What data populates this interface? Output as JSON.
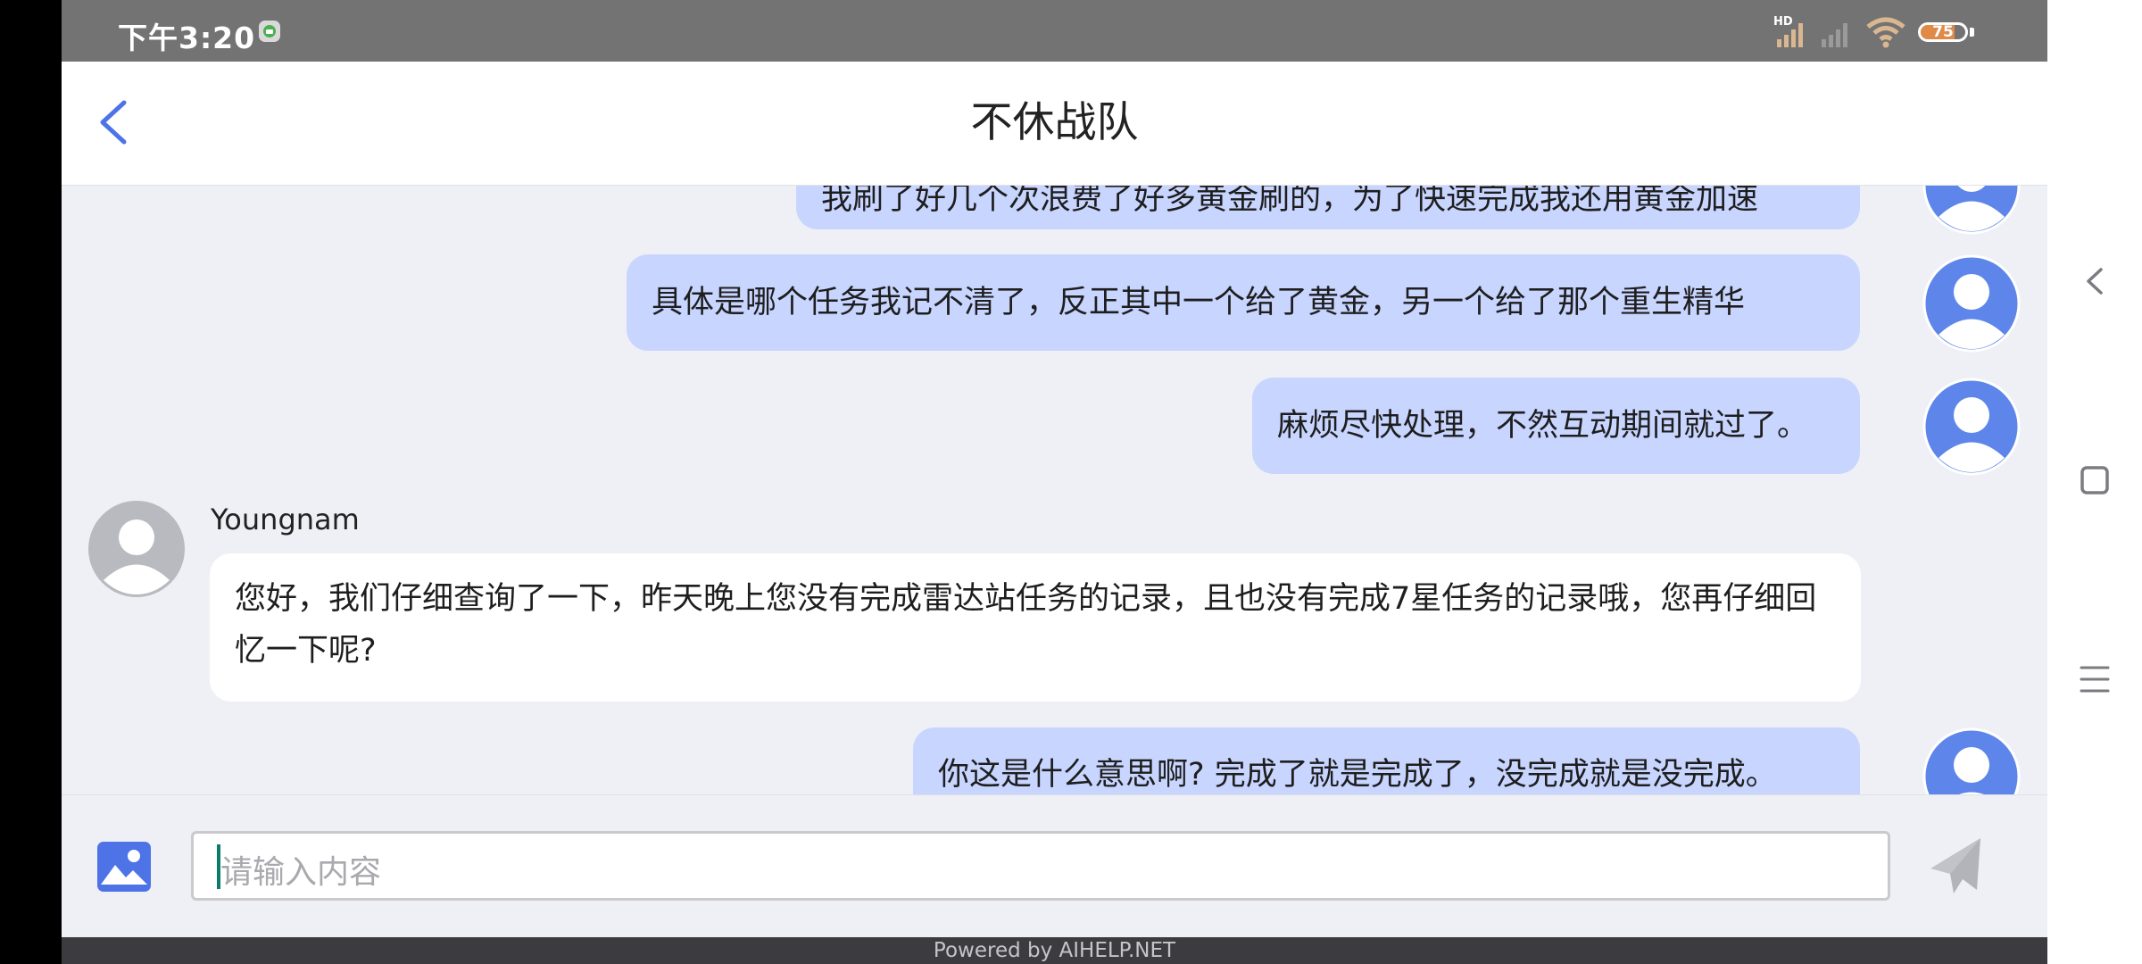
{
  "status_bar": {
    "time": "下午3:20",
    "signal_label": "HD",
    "battery_percent": 75,
    "battery_label": "75",
    "battery_color": "#e08a48"
  },
  "header": {
    "title": "不休战队",
    "back_icon": "chevron-left-icon",
    "accent_color": "#4d73e6"
  },
  "messages": [
    {
      "direction": "outgoing",
      "text": "我刷了好几个次浪费了好多黄金刷的，为了快速完成我还用黄金加速"
    },
    {
      "direction": "outgoing",
      "text": "具体是哪个任务我记不清了，反正其中一个给了黄金，另一个给了那个重生精华"
    },
    {
      "direction": "outgoing",
      "text": "麻烦尽快处理，不然互动期间就过了。"
    },
    {
      "direction": "incoming",
      "sender": "Youngnam",
      "text": "您好，我们仔细查询了一下，昨天晚上您没有完成雷达站任务的记录，且也没有完成7星任务的记录哦，您再仔细回忆一下呢?"
    },
    {
      "direction": "outgoing",
      "text": "你这是什么意思啊? 完成了就是完成了，没完成就是没完成。"
    }
  ],
  "input": {
    "placeholder": "请输入内容",
    "image_icon": "image-icon",
    "send_icon": "send-icon"
  },
  "footer": {
    "text": "Powered by AIHELP.NET"
  },
  "system_nav": {
    "back_icon": "chevron-left-icon",
    "home_icon": "square-icon",
    "menu_icon": "menu-icon"
  }
}
